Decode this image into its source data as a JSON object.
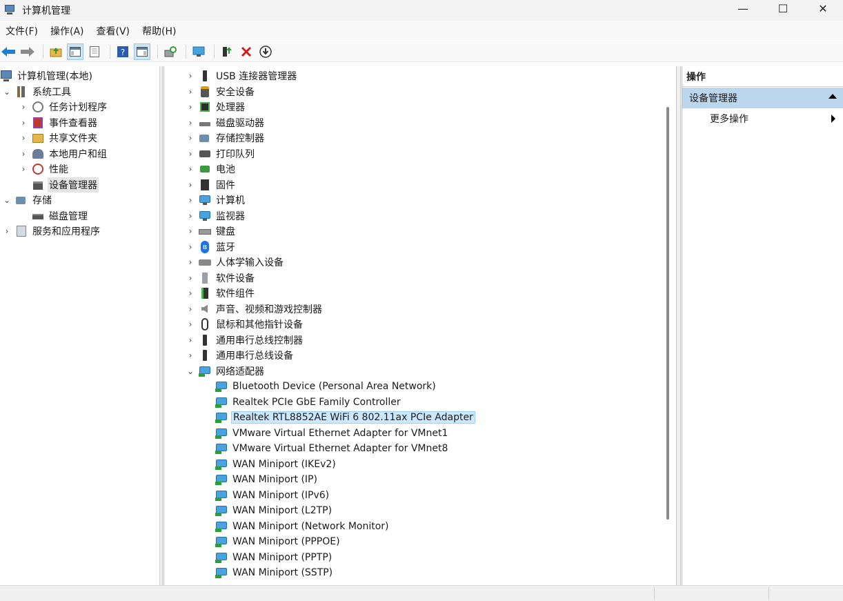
{
  "window": {
    "title": "计算机管理",
    "min_glyph": "—",
    "max_glyph": "☐",
    "close_glyph": "✕"
  },
  "menu": [
    "文件(F)",
    "操作(A)",
    "查看(V)",
    "帮助(H)"
  ],
  "left_tree": [
    {
      "label": "计算机管理(本地)",
      "icon": "computer-icon",
      "chev": ""
    },
    {
      "label": "系统工具",
      "icon": "tools-icon",
      "chev": "⌄"
    },
    {
      "label": "任务计划程序",
      "icon": "clock-icon",
      "chev": "›"
    },
    {
      "label": "事件查看器",
      "icon": "event-viewer-icon",
      "chev": "›"
    },
    {
      "label": "共享文件夹",
      "icon": "shared-folder-icon",
      "chev": "›"
    },
    {
      "label": "本地用户和组",
      "icon": "users-icon",
      "chev": "›"
    },
    {
      "label": "性能",
      "icon": "performance-icon",
      "chev": "›"
    },
    {
      "label": "设备管理器",
      "icon": "device-manager-icon",
      "chev": ""
    },
    {
      "label": "存储",
      "icon": "storage-icon",
      "chev": "⌄"
    },
    {
      "label": "磁盘管理",
      "icon": "disk-management-icon",
      "chev": ""
    },
    {
      "label": "服务和应用程序",
      "icon": "services-icon",
      "chev": "›"
    }
  ],
  "device_categories": [
    {
      "label": "USB 连接器管理器",
      "icon": "usb-icon"
    },
    {
      "label": "安全设备",
      "icon": "security-icon"
    },
    {
      "label": "处理器",
      "icon": "processor-icon"
    },
    {
      "label": "磁盘驱动器",
      "icon": "disk-drive-icon"
    },
    {
      "label": "存储控制器",
      "icon": "storage-controller-icon"
    },
    {
      "label": "打印队列",
      "icon": "printer-icon"
    },
    {
      "label": "电池",
      "icon": "battery-icon"
    },
    {
      "label": "固件",
      "icon": "firmware-icon"
    },
    {
      "label": "计算机",
      "icon": "computer-icon"
    },
    {
      "label": "监视器",
      "icon": "monitor-icon"
    },
    {
      "label": "键盘",
      "icon": "keyboard-icon"
    },
    {
      "label": "蓝牙",
      "icon": "bluetooth-icon"
    },
    {
      "label": "人体学输入设备",
      "icon": "hid-icon"
    },
    {
      "label": "软件设备",
      "icon": "software-device-icon"
    },
    {
      "label": "软件组件",
      "icon": "software-component-icon"
    },
    {
      "label": "声音、视频和游戏控制器",
      "icon": "speaker-icon"
    },
    {
      "label": "鼠标和其他指针设备",
      "icon": "mouse-icon"
    },
    {
      "label": "通用串行总线控制器",
      "icon": "usb-icon"
    },
    {
      "label": "通用串行总线设备",
      "icon": "usb-icon"
    },
    {
      "label": "网络适配器",
      "icon": "network-adapter-icon"
    }
  ],
  "network_adapters": [
    "Bluetooth Device (Personal Area Network)",
    "Realtek PCIe GbE Family Controller",
    "Realtek RTL8852AE WiFi 6 802.11ax PCIe Adapter",
    "VMware Virtual Ethernet Adapter for VMnet1",
    "VMware Virtual Ethernet Adapter for VMnet8",
    "WAN Miniport (IKEv2)",
    "WAN Miniport (IP)",
    "WAN Miniport (IPv6)",
    "WAN Miniport (L2TP)",
    "WAN Miniport (Network Monitor)",
    "WAN Miniport (PPPOE)",
    "WAN Miniport (PPTP)",
    "WAN Miniport (SSTP)"
  ],
  "actions": {
    "header": "操作",
    "section": "设备管理器",
    "more": "更多操作"
  },
  "colors": {
    "selected_blue": "#cce8ff",
    "section_blue": "#bcd6ee"
  }
}
